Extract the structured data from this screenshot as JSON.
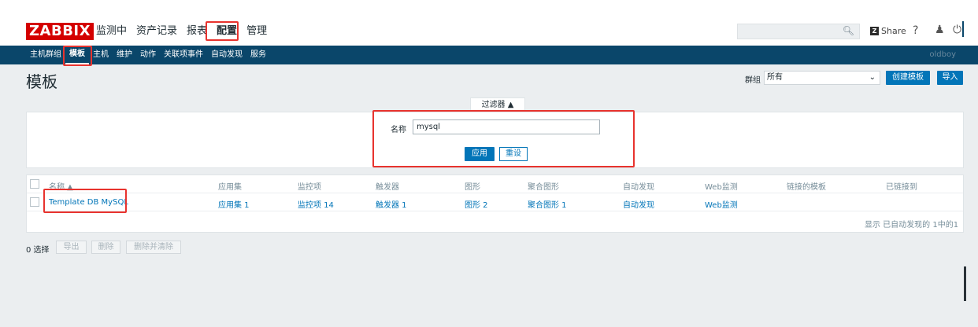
{
  "app": {
    "logo": "ZABBIX"
  },
  "main_menu": [
    {
      "label": "监测中"
    },
    {
      "label": "资产记录"
    },
    {
      "label": "报表"
    },
    {
      "label": "配置"
    },
    {
      "label": "管理"
    }
  ],
  "top_right": {
    "share": "Share",
    "help": "?",
    "user": "♟",
    "power": "⏻"
  },
  "sub_menu": [
    {
      "label": "主机群组"
    },
    {
      "label": "模板"
    },
    {
      "label": "主机"
    },
    {
      "label": "维护"
    },
    {
      "label": "动作"
    },
    {
      "label": "关联项事件"
    },
    {
      "label": "自动发现"
    },
    {
      "label": "服务"
    }
  ],
  "sub_menu_right": "oldboy",
  "page": {
    "title": "模板",
    "group_label": "群组",
    "group_value": "所有",
    "create_button": "创建模板",
    "import_button": "导入"
  },
  "filter": {
    "tab_label": "过滤器 ▲",
    "name_label": "名称",
    "name_value": "mysql",
    "apply": "应用",
    "reset": "重设"
  },
  "table": {
    "headers": [
      "名称 ▲",
      "应用集",
      "监控项",
      "触发器",
      "图形",
      "聚合图形",
      "自动发现",
      "Web监测",
      "链接的模板",
      "已链接到"
    ],
    "rows": [
      [
        "Template DB MySQL",
        "应用集 1",
        "监控项 14",
        "触发器 1",
        "图形 2",
        "聚合图形 1",
        "自动发现",
        "Web监测",
        "",
        ""
      ]
    ],
    "footer": "显示 已自动发现的 1中的1"
  },
  "bulk": {
    "selected": "0 选择",
    "export": "导出",
    "delete": "删除",
    "delete_clear": "删除并清除"
  },
  "colors": {
    "accent": "#0275b8",
    "nav": "#0a466a",
    "logo": "#d40000",
    "highlight": "#e8332e"
  }
}
